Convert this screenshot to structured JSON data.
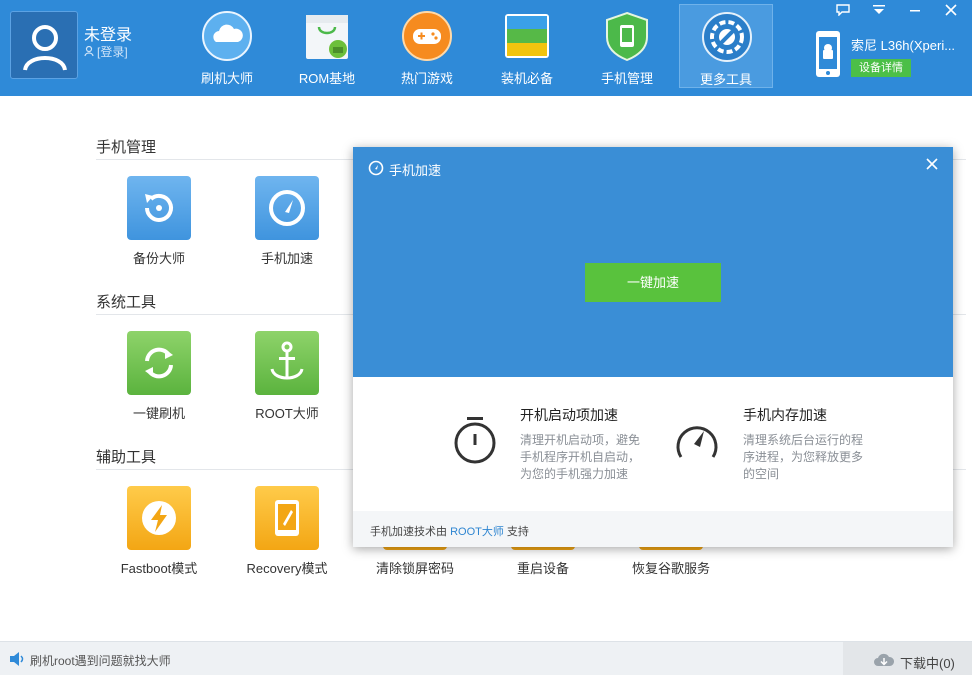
{
  "user": {
    "name": "未登录",
    "login_link": "[登录]"
  },
  "nav": [
    {
      "label": "刷机大师",
      "icon": "cloud-icon"
    },
    {
      "label": "ROM基地",
      "icon": "shopping-bag-android-icon"
    },
    {
      "label": "热门游戏",
      "icon": "gamepad-icon"
    },
    {
      "label": "装机必备",
      "icon": "apps-stack-icon"
    },
    {
      "label": "手机管理",
      "icon": "shield-phone-icon"
    },
    {
      "label": "更多工具",
      "icon": "wrench-gear-icon",
      "active": true
    }
  ],
  "device": {
    "name": "索尼 L36h(Xperi...",
    "detail_button": "设备详情"
  },
  "sections": [
    {
      "title": "手机管理",
      "tools": [
        {
          "label": "备份大师"
        },
        {
          "label": "手机加速"
        }
      ]
    },
    {
      "title": "系统工具",
      "tools": [
        {
          "label": "一键刷机"
        },
        {
          "label": "ROOT大师"
        }
      ]
    },
    {
      "title": "辅助工具",
      "tools": [
        {
          "label": "Fastboot模式"
        },
        {
          "label": "Recovery模式"
        },
        {
          "label": "清除锁屏密码"
        },
        {
          "label": "重启设备"
        },
        {
          "label": "恢复谷歌服务"
        }
      ]
    }
  ],
  "modal": {
    "title": "手机加速",
    "boost_button": "一键加速",
    "features": [
      {
        "title": "开机启动项加速",
        "desc": [
          "清理开机启动项，避免",
          "手机程序开机自启动，",
          "为您的手机强力加速"
        ]
      },
      {
        "title": "手机内存加速",
        "desc": [
          "清理系统后台运行的程",
          "序进程，为您释放更多",
          "的空间"
        ]
      }
    ],
    "footer": {
      "prefix": "手机加速技术由 ",
      "link": "ROOT大师",
      "suffix": " 支持"
    }
  },
  "status": {
    "message": "刷机root遇到问题就找大师",
    "downloads": "下载中(0)"
  },
  "colors": {
    "primary": "#2f8ad8",
    "accent_green": "#59c23d",
    "link": "#2f86d1"
  }
}
